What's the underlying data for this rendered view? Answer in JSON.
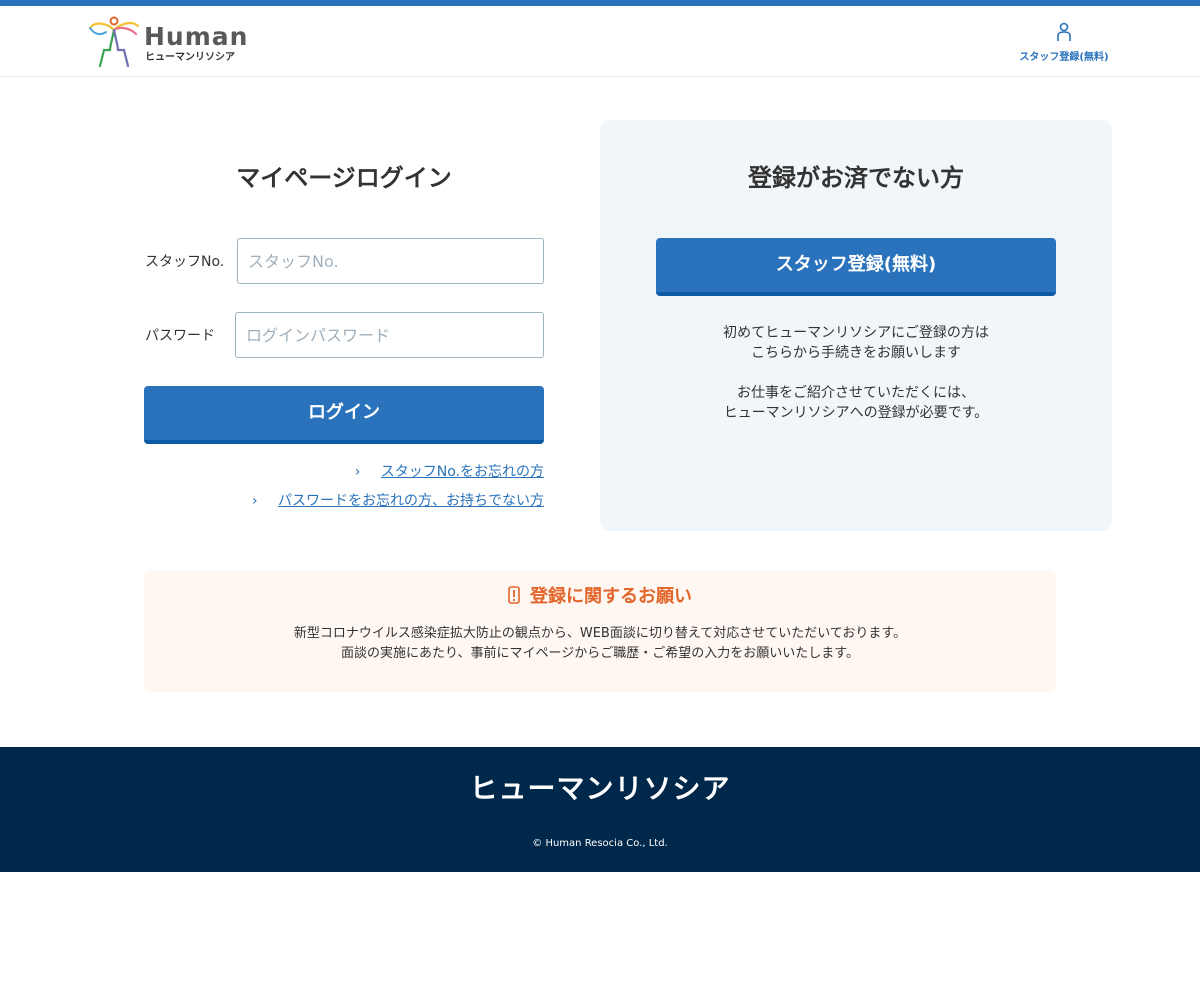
{
  "header": {
    "logo_word": "Human",
    "logo_sub": "ヒューマンリソシア",
    "staff_register_label": "スタッフ登録(無料)",
    "staff_register_icon": "person-icon"
  },
  "login": {
    "title": "マイページログイン",
    "staff_no_label": "スタッフNo.",
    "staff_no_placeholder": "スタッフNo.",
    "password_label": "パスワード",
    "password_placeholder": "ログインパスワード",
    "login_button": "ログイン",
    "forgot_staff_no_link": "スタッフNo.をお忘れの方",
    "forgot_password_link": "パスワードをお忘れの方、お持ちでない方"
  },
  "register": {
    "title": "登録がお済でない方",
    "button": "スタッフ登録(無料)",
    "text_line1": "初めてヒューマンリソシアにご登録の方は",
    "text_line2": "こちらから手続きをお願いします",
    "text_line3": "お仕事をご紹介させていただくには、",
    "text_line4": "ヒューマンリソシアへの登録が必要です。"
  },
  "notice": {
    "title": "登録に関するお願い",
    "icon": "warning-icon",
    "line1": "新型コロナウイルス感染症拡大防止の観点から、WEB面談に切り替えて対応させていただいております。",
    "line2": "面談の実施にあたり、事前にマイページからご職歴・ご希望の入力をお願いいたします。"
  },
  "footer": {
    "logo": "ヒューマンリソシア",
    "copyright": "© Human Resocia Co., Ltd."
  },
  "colors": {
    "accent": "#2a73bc",
    "footer_bg": "#00284a",
    "notice_accent": "#e2652a",
    "panel_bg": "#f0f6f9",
    "notice_bg": "#fff7f2"
  }
}
